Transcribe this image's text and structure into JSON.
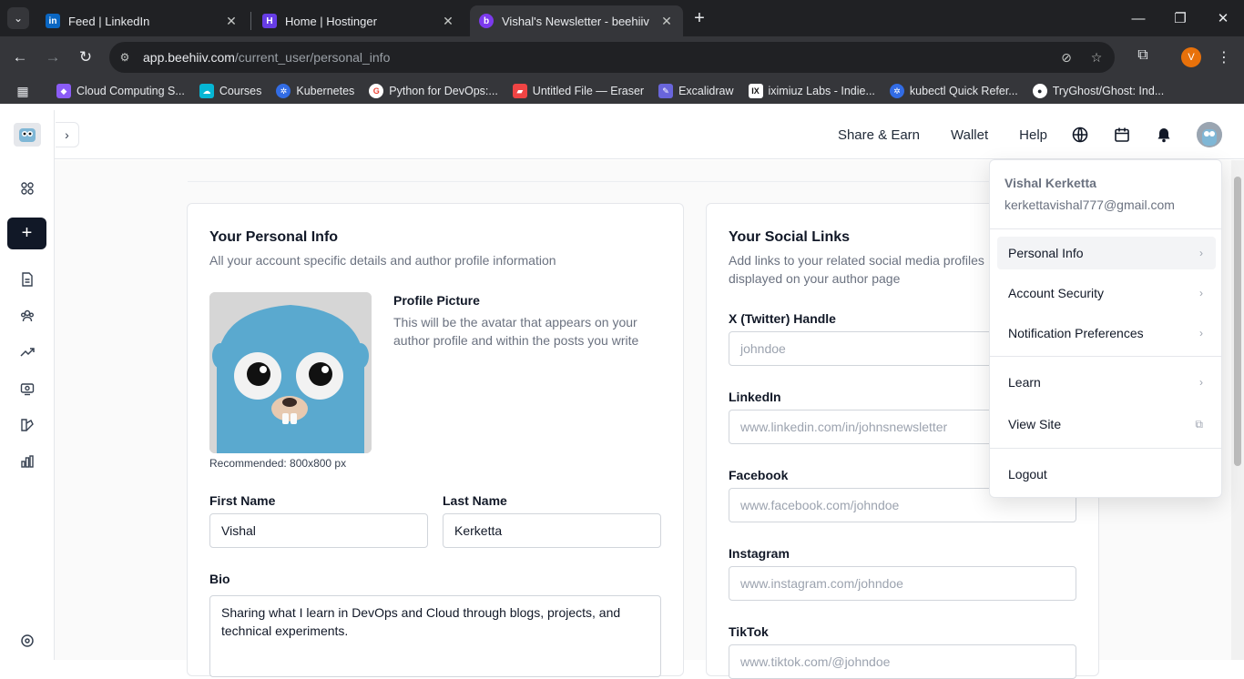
{
  "browser": {
    "tabs": [
      {
        "title": "Feed | LinkedIn",
        "favicon": "linkedin-icon"
      },
      {
        "title": "Home | Hostinger",
        "favicon": "hostinger-icon"
      },
      {
        "title": "Vishal's Newsletter - beehiiv",
        "favicon": "beehiiv-icon",
        "active": true
      }
    ],
    "url_host": "app.beehiiv.com",
    "url_path": "/current_user/personal_info",
    "profile_initial": "V",
    "bookmarks": [
      {
        "label": "Cloud Computing S...",
        "icon": "cube-icon",
        "color": "#8b5cf6"
      },
      {
        "label": "Courses",
        "icon": "cloud-icon",
        "color": "#06b6d4"
      },
      {
        "label": "Kubernetes",
        "icon": "kubernetes-icon",
        "color": "#326ce5"
      },
      {
        "label": "Python for DevOps:...",
        "icon": "google-icon",
        "color": "#ea4335"
      },
      {
        "label": "Untitled File — Eraser",
        "icon": "eraser-icon",
        "color": "#ef4444"
      },
      {
        "label": "Excalidraw",
        "icon": "excalidraw-icon",
        "color": "#6965db"
      },
      {
        "label": "iximiuz Labs - Indie...",
        "icon": "iximiuz-icon",
        "color": "#111111"
      },
      {
        "label": "kubectl Quick Refer...",
        "icon": "kubernetes-icon",
        "color": "#326ce5"
      },
      {
        "label": "TryGhost/Ghost: Ind...",
        "icon": "github-icon",
        "color": "#24292f"
      }
    ]
  },
  "header": {
    "share_earn": "Share & Earn",
    "wallet": "Wallet",
    "help": "Help"
  },
  "personal_info": {
    "title": "Your Personal Info",
    "description": "All your account specific details and author profile information",
    "profile_picture_label": "Profile Picture",
    "profile_picture_desc": "This will be the avatar that appears on your author profile and within the posts you write",
    "recommended": "Recommended: 800x800 px",
    "first_name_label": "First Name",
    "first_name_value": "Vishal",
    "last_name_label": "Last Name",
    "last_name_value": "Kerketta",
    "bio_label": "Bio",
    "bio_value": "Sharing what I learn in DevOps and Cloud through blogs, projects, and technical experiments."
  },
  "social_links": {
    "title": "Your Social Links",
    "description": "Add links to your related social media profiles displayed on your author page",
    "fields": [
      {
        "label": "X (Twitter) Handle",
        "placeholder": "johndoe"
      },
      {
        "label": "LinkedIn",
        "placeholder": "www.linkedin.com/in/johnsnewsletter"
      },
      {
        "label": "Facebook",
        "placeholder": "www.facebook.com/johndoe"
      },
      {
        "label": "Instagram",
        "placeholder": "www.instagram.com/johndoe"
      },
      {
        "label": "TikTok",
        "placeholder": "www.tiktok.com/@johndoe"
      }
    ]
  },
  "user_menu": {
    "name": "Vishal Kerketta",
    "email": "kerkettavishal777@gmail.com",
    "items": [
      "Personal Info",
      "Account Security",
      "Notification Preferences"
    ],
    "learn": "Learn",
    "view_site": "View Site",
    "logout": "Logout"
  }
}
